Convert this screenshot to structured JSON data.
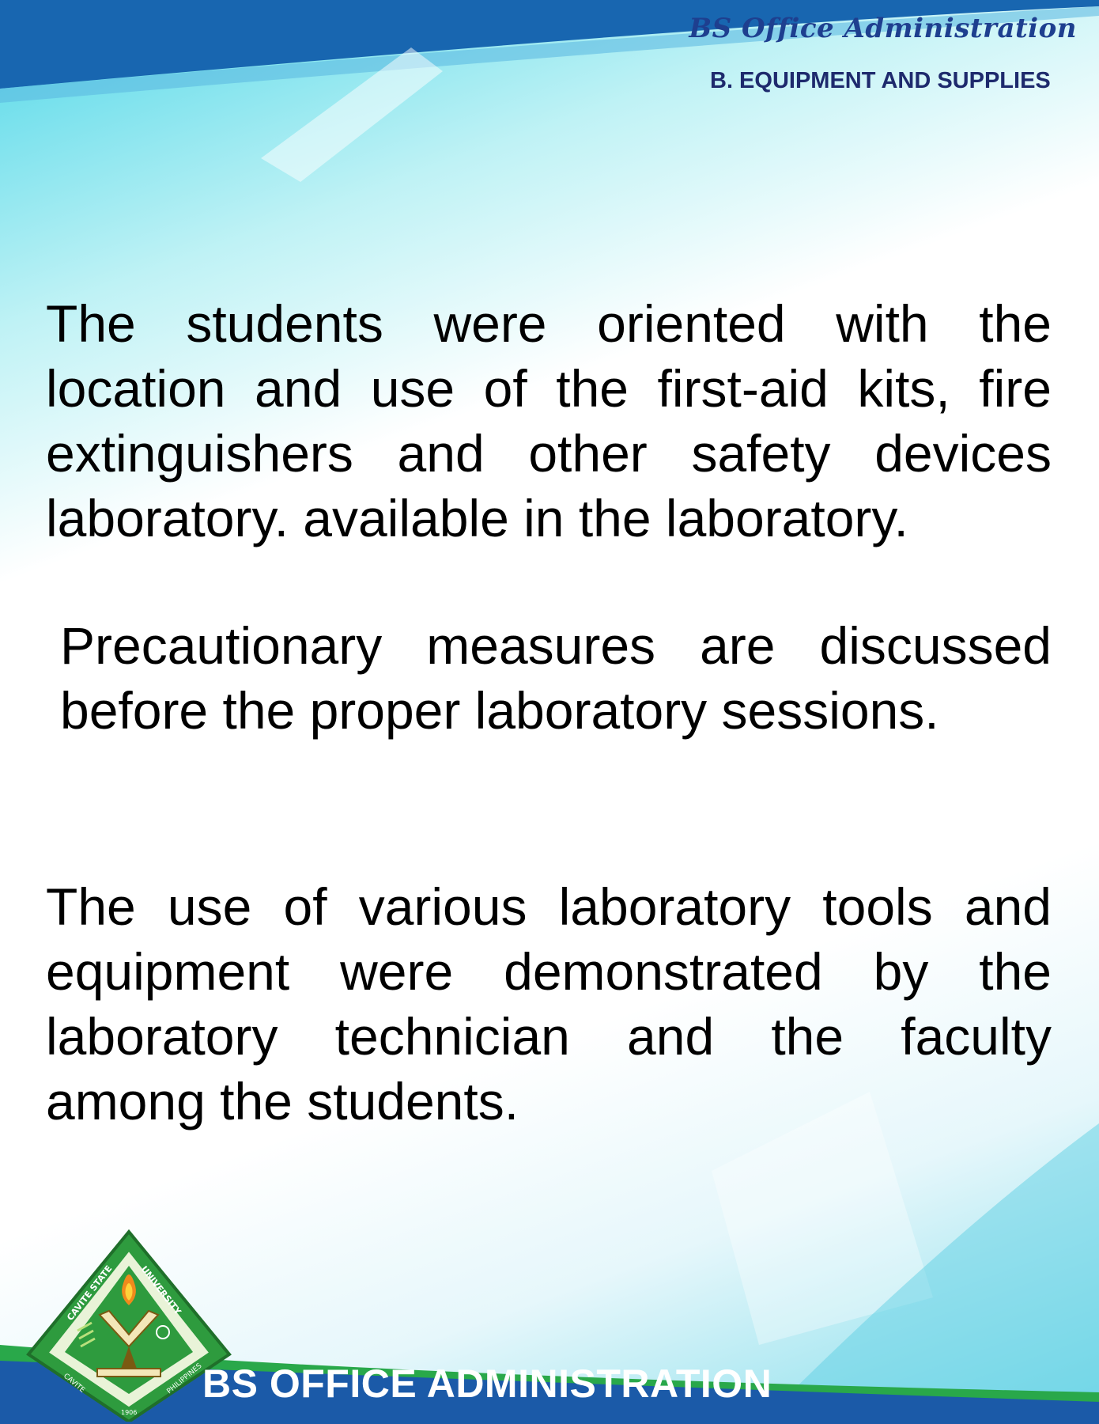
{
  "header": {
    "program_script": "BS Office Administration",
    "section_title": "B. EQUIPMENT AND SUPPLIES"
  },
  "body": {
    "paragraph_1": "The students were oriented with the location and use of the first-aid kits, fire extinguishers and other safety devices laboratory. available in the laboratory.",
    "paragraph_2": "Precautionary measures are discussed before the proper laboratory sessions.",
    "paragraph_3": "The use of various laboratory tools and equipment were demonstrated by the laboratory technician and the faculty among the students."
  },
  "footer": {
    "title": "BS OFFICE ADMINISTRATION",
    "seal_text_left": "CAVITE STATE",
    "seal_text_right": "UNIVERSITY",
    "seal_text_bottom_left": "CAVITE",
    "seal_text_bottom_right": "PHILIPPINES",
    "seal_year": "1906"
  },
  "colors": {
    "header_band": "#1866b0",
    "footer_band": "#1b5aa8",
    "footer_green": "#29a84a",
    "header_text": "#1e3f8f"
  }
}
